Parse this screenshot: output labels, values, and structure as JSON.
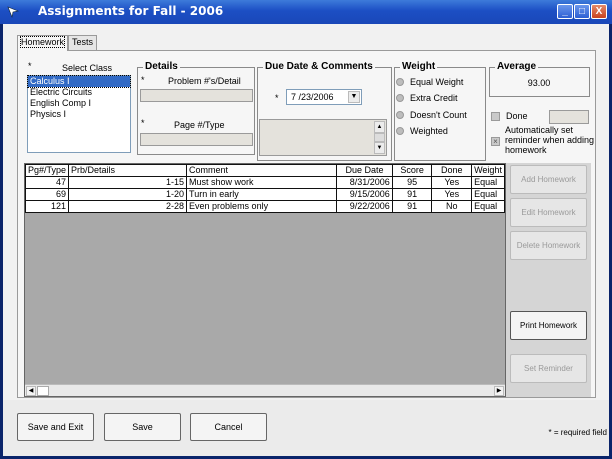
{
  "window": {
    "title": "Assignments for Fall - 2006",
    "minimize": "_",
    "maximize": "□",
    "close": "X"
  },
  "tabs": [
    {
      "label": "Homework",
      "active": true
    },
    {
      "label": "Tests",
      "active": false
    }
  ],
  "select_class": {
    "label": "Select Class",
    "required_mark": "*",
    "items": [
      "Calculus I",
      "Electric Circuits",
      "English Comp I",
      "Physics I"
    ],
    "selected": "Calculus I"
  },
  "details": {
    "heading": "Details",
    "problem_label": "Problem #'s/Detail",
    "problem_value": "",
    "page_label": "Page #/Type",
    "page_value": "",
    "required_mark": "*"
  },
  "due_date": {
    "heading": "Due Date & Comments",
    "required_mark": "*",
    "date_value": "7 /23/2006",
    "comments_value": ""
  },
  "weight": {
    "heading": "Weight",
    "options": [
      "Equal Weight",
      "Extra Credit",
      "Doesn't Count",
      "Weighted"
    ],
    "selected": "Equal Weight"
  },
  "average": {
    "heading": "Average",
    "value": "93.00",
    "done_label": "Done",
    "reminder_label_1": "Automatically set",
    "reminder_label_2": "reminder when adding",
    "reminder_label_3": "homework",
    "reminder_checked": true
  },
  "grid": {
    "columns": [
      "Pg#/Type",
      "Prb/Details",
      "Comment",
      "Due Date",
      "Score",
      "Done",
      "Weight"
    ],
    "rows": [
      [
        "47",
        "1-15",
        "Must show work",
        "8/31/2006",
        "95",
        "Yes",
        "Equal"
      ],
      [
        "69",
        "1-20",
        "Turn in early",
        "9/15/2006",
        "91",
        "Yes",
        "Equal"
      ],
      [
        "121",
        "2-28",
        "Even problems only",
        "9/22/2006",
        "91",
        "No",
        "Equal"
      ]
    ]
  },
  "side_buttons": {
    "add": "Add Homework",
    "edit": "Edit Homework",
    "delete": "Delete Homework",
    "print": "Print Homework",
    "reminder": "Set Reminder"
  },
  "footer": {
    "save_exit": "Save and Exit",
    "save": "Save",
    "cancel": "Cancel",
    "required_note": "* = required field"
  },
  "colors": {
    "titlebar": "#1c4fc4",
    "selection": "#316ac5"
  }
}
